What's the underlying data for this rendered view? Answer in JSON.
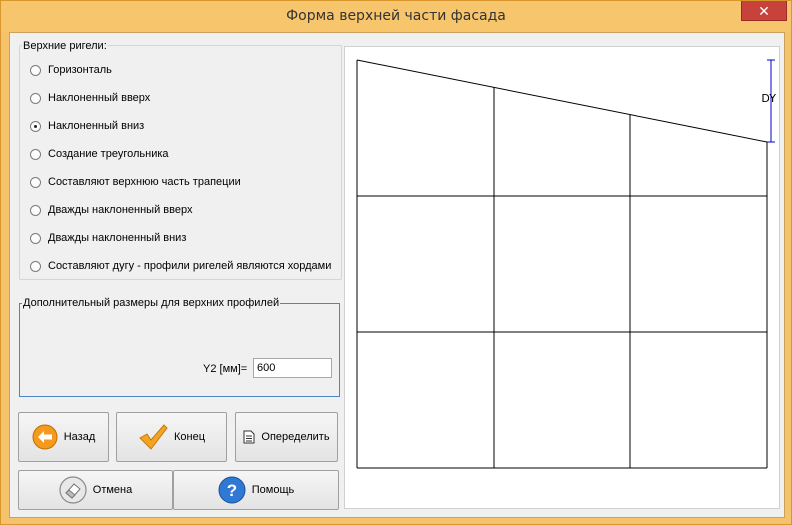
{
  "window": {
    "title": "Форма верхней части фасада",
    "close_glyph": "✕"
  },
  "top_rail_group": {
    "legend": "Верхние ригели:",
    "options": [
      {
        "label": "Горизонталь",
        "checked": false
      },
      {
        "label": "Наклоненный вверх",
        "checked": false
      },
      {
        "label": "Наклоненный вниз",
        "checked": true
      },
      {
        "label": "Создание треугольника",
        "checked": false
      },
      {
        "label": "Составляют верхнюю часть трапеции",
        "checked": false
      },
      {
        "label": "Дважды наклоненный вверх",
        "checked": false
      },
      {
        "label": "Дважды наклоненный вниз",
        "checked": false
      },
      {
        "label": "Составляют дугу - профили ригелей являются хордами",
        "checked": false
      }
    ]
  },
  "dimensions_group": {
    "legend": "Дополнительный размеры для верхних профилей",
    "y2_label": "Y2 [мм]=",
    "y2_value": "600"
  },
  "buttons": {
    "back": {
      "label": "Назад",
      "icon": "arrow-left-icon"
    },
    "finish": {
      "label": "Конец",
      "icon": "checkmark-icon"
    },
    "define": {
      "label": "Опеределить",
      "icon": "document-icon"
    },
    "cancel": {
      "label": "Отмена",
      "icon": "eraser-icon"
    },
    "help": {
      "label": "Помощь",
      "icon": "help-icon"
    }
  },
  "drawing": {
    "dimension_label": "DY",
    "line_color": "#000000",
    "dimension_color": "#0000cc"
  },
  "colors": {
    "title_bar": "#f7c56c",
    "close_button": "#c7423a",
    "group_border_active": "#4a86c8"
  }
}
